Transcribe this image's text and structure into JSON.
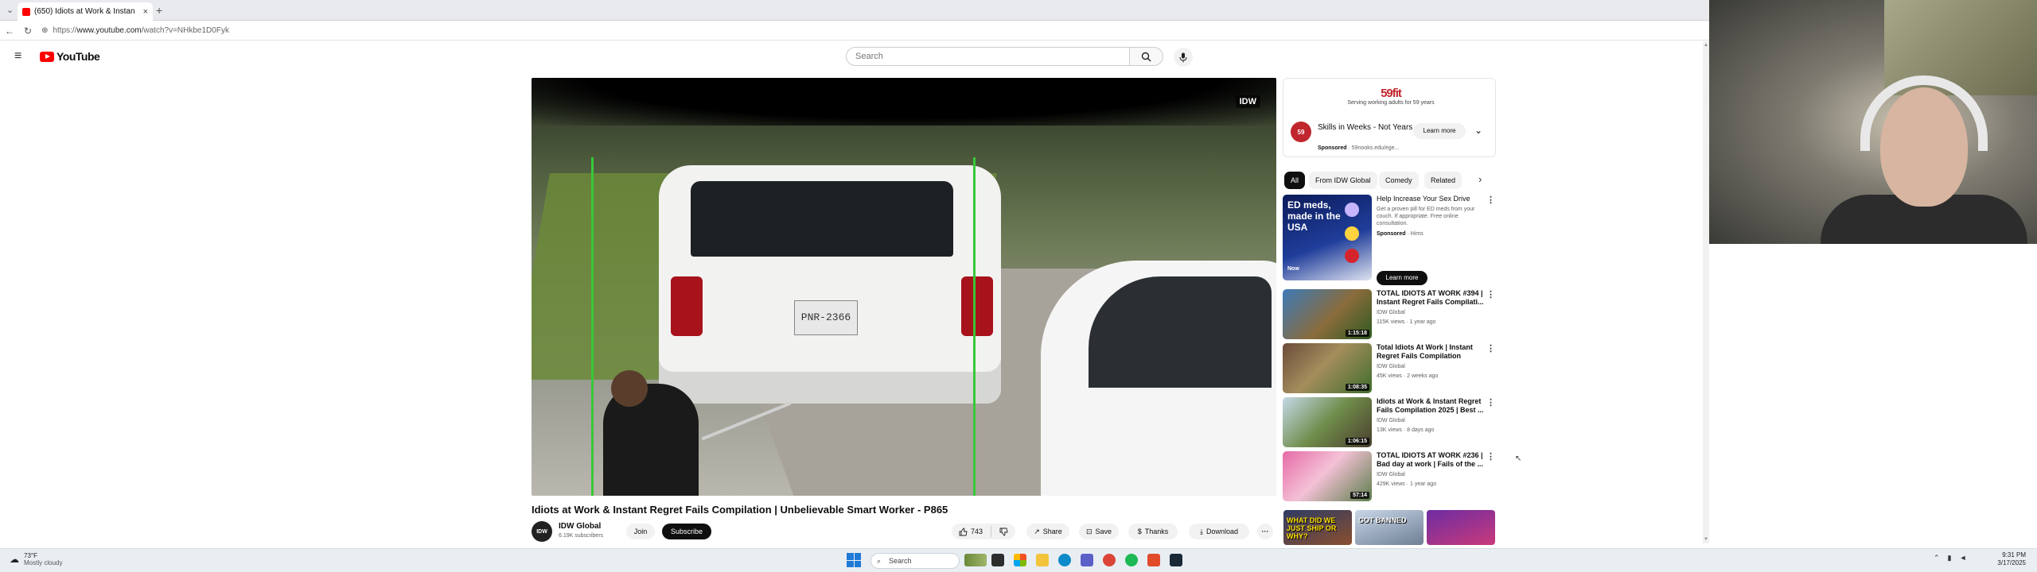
{
  "browser": {
    "tab_title": "(650) Idiots at Work & Instan",
    "tab_close": "×",
    "new_tab": "+",
    "url_host": "https://",
    "url_main": "www.youtube.com",
    "url_rest": "/watch?v=NHkbe1D0Fyk"
  },
  "youtube": {
    "logo_text": "YouTube",
    "search_placeholder": "Search"
  },
  "video": {
    "watermark": "IDW",
    "plate": "PNR-2366",
    "title": "Idiots at Work & Instant Regret Fails Compilation | Unbelievable Smart Worker - P865",
    "channel_avatar": "IDW",
    "channel_name": "IDW Global",
    "subscribers": "6.19K subscribers",
    "join": "Join",
    "subscribe": "Subscribe",
    "likes": "743",
    "share": "Share",
    "save": "Save",
    "thanks": "Thanks",
    "download": "Download",
    "more": "···"
  },
  "ad": {
    "banner_big": "59fit",
    "banner_small": "Serving working adults for 59 years",
    "icon_text": "59",
    "title": "Skills in Weeks - Not Years",
    "sponsored": "Sponsored",
    "domain": "· 59nooks.edu/ege...",
    "learn_more": "Learn more",
    "chevron": "⌄"
  },
  "chips": [
    "All",
    "From IDW Global",
    "Comedy",
    "Related"
  ],
  "chip_next": "›",
  "sponsored_rec": {
    "thumb_text": "ED meds, made in the USA",
    "thumb_badge": "Now",
    "title": "Help Increase Your Sex Drive",
    "desc": "Get a proven pill for ED meds from your couch. If appropriate. Free online consultation.",
    "sponsored": "Sponsored",
    "advertiser": "· Hims",
    "learn_more": "Learn more"
  },
  "recs": [
    {
      "title": "TOTAL IDIOTS AT WORK #394 | Instant Regret Fails Compilati...",
      "channel": "IDW Global",
      "meta": "115K views · 1 year ago",
      "duration": "1:15:18"
    },
    {
      "title": "Total Idiots At Work | Instant Regret Fails Compilation 2025...",
      "channel": "IDW Global",
      "meta": "45K views · 2 weeks ago",
      "duration": "1:08:35"
    },
    {
      "title": "Idiots at Work & Instant Regret Fails Compilation 2025 | Best ...",
      "channel": "IDW Global",
      "meta": "13K views · 8 days ago",
      "duration": "1:06:15"
    },
    {
      "title": "TOTAL IDIOTS AT WORK #236 | Bad day at work | Fails of the ...",
      "channel": "IDW Global",
      "meta": "429K views · 1 year ago",
      "duration": "57:14"
    }
  ],
  "shorts": [
    "WHAT DID WE JUST SHIP OR WHY?",
    "GOT BANNED",
    ""
  ],
  "taskbar": {
    "weather_temp": "73°F",
    "weather_desc": "Mostly cloudy",
    "search": "Search",
    "time": "9:31 PM",
    "date": "3/17/2025"
  },
  "colors": {
    "yt_red": "#ff0000",
    "subscribe_bg": "#0f0f0f",
    "chip_bg": "#f2f2f2",
    "ad_brand": "#c0262d"
  }
}
